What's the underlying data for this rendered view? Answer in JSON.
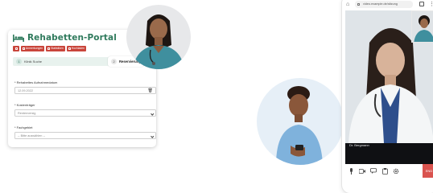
{
  "portal": {
    "title": "Rehabetten-Portal",
    "tabs": [
      {
        "label": ""
      },
      {
        "label": "Anmerkungen"
      },
      {
        "label": "Statistiken"
      },
      {
        "label": "Hochladen"
      }
    ],
    "steps": [
      {
        "number": "1",
        "label": "Klinik Suche"
      },
      {
        "number": "2",
        "label": "Reservierung"
      }
    ],
    "fields": {
      "date_label": "* Rehabettes Aufnahmedatum",
      "date_value": "12.09.2022",
      "cost_label": "* Kostenträger",
      "cost_value": "Rentenversig",
      "facility_label": "* Fachgebiet",
      "facility_value": "-- Bitte auswählen --"
    }
  },
  "video_call": {
    "url": "video.example.de/sitzung",
    "doctor_name": "Dr. Bergmann",
    "end_label": "END"
  },
  "colors": {
    "brand_green": "#2f7a5c",
    "tab_red": "#c9453b",
    "end_call_red": "#d9534f"
  }
}
